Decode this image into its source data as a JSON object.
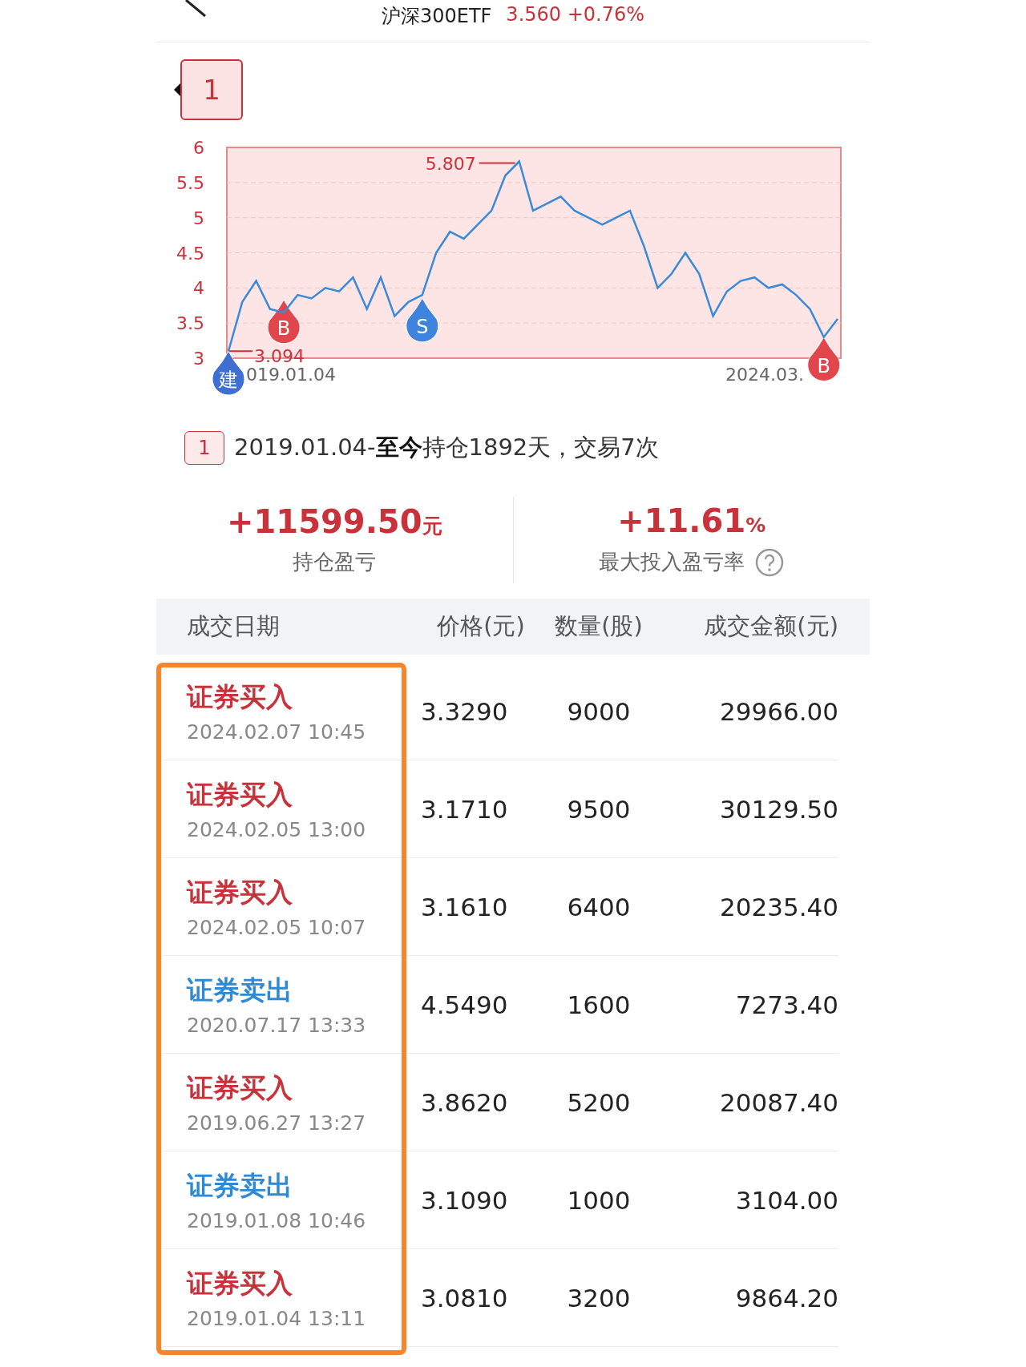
{
  "header": {
    "title": "沪深300ETF",
    "price": "3.560",
    "change": "+0.76%"
  },
  "legend": {
    "label": "1"
  },
  "chart": {
    "chart_data": {
      "type": "line",
      "grid": true,
      "ylim": [
        3,
        6
      ],
      "yticks": [
        3,
        3.5,
        4,
        4.5,
        5,
        5.5,
        6
      ],
      "series": [
        {
          "color": "#3a8ad8",
          "values": [
            3.1,
            3.8,
            4.1,
            3.7,
            3.65,
            3.9,
            3.85,
            4.0,
            3.95,
            4.15,
            3.7,
            4.15,
            3.6,
            3.8,
            3.9,
            4.5,
            4.8,
            4.7,
            4.9,
            5.1,
            5.6,
            5.8,
            5.1,
            5.2,
            5.3,
            5.1,
            5.0,
            4.9,
            5.0,
            5.1,
            4.6,
            4.0,
            4.2,
            4.5,
            4.2,
            3.6,
            3.95,
            4.1,
            4.15,
            4.0,
            4.05,
            3.9,
            3.7,
            3.3,
            3.56
          ]
        }
      ],
      "annotations": [
        "5.807",
        "3.094"
      ]
    },
    "x_start_label": "019.01.04",
    "x_end_label": "2024.03.",
    "markers": [
      {
        "kind": "open",
        "label": "建"
      },
      {
        "kind": "buy",
        "label": "B"
      },
      {
        "kind": "sell",
        "label": "S"
      },
      {
        "kind": "buy",
        "label": "B"
      }
    ]
  },
  "summary": {
    "tag": "1",
    "text": "2019.01.04-**至今**持仓1892天，交易7次"
  },
  "stats": [
    {
      "value": "+11599.50",
      "unit": "元",
      "label": "持仓盈亏",
      "help": false
    },
    {
      "value": "+11.61",
      "unit": "%",
      "label": "最大投入盈亏率",
      "help": true
    }
  ],
  "table": {
    "columns": [
      "成交日期",
      "价格(元)",
      "数量(股)",
      "成交金额(元)"
    ],
    "highlight_first_column": true,
    "rows": [
      {
        "kind": "buy",
        "action": "证券买入",
        "time": "2024.02.07 10:45",
        "price": "3.3290",
        "qty": "9000",
        "amount": "29966.00"
      },
      {
        "kind": "buy",
        "action": "证券买入",
        "time": "2024.02.05 13:00",
        "price": "3.1710",
        "qty": "9500",
        "amount": "30129.50"
      },
      {
        "kind": "buy",
        "action": "证券买入",
        "time": "2024.02.05 10:07",
        "price": "3.1610",
        "qty": "6400",
        "amount": "20235.40"
      },
      {
        "kind": "sell",
        "action": "证券卖出",
        "time": "2020.07.17 13:33",
        "price": "4.5490",
        "qty": "1600",
        "amount": "7273.40"
      },
      {
        "kind": "buy",
        "action": "证券买入",
        "time": "2019.06.27 13:27",
        "price": "3.8620",
        "qty": "5200",
        "amount": "20087.40"
      },
      {
        "kind": "sell",
        "action": "证券卖出",
        "time": "2019.01.08 10:46",
        "price": "3.1090",
        "qty": "1000",
        "amount": "3104.00"
      },
      {
        "kind": "buy",
        "action": "证券买入",
        "time": "2019.01.04 13:11",
        "price": "3.0810",
        "qty": "3200",
        "amount": "9864.20"
      }
    ]
  }
}
